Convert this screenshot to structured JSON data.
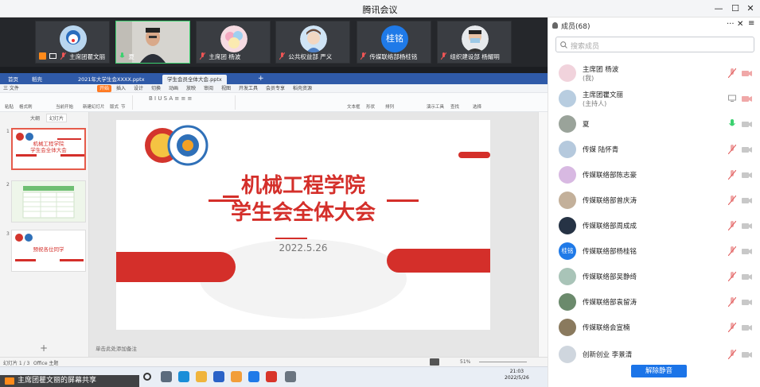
{
  "window": {
    "title": "腾讯会议",
    "min_label": "—",
    "max_label": "☐",
    "close_label": "✕"
  },
  "video_strip": [
    {
      "name": "主席团瞿文丽",
      "avatar_color": "#9ec3e6"
    },
    {
      "name": "夏",
      "avatar_color": "#c9c3ba"
    },
    {
      "name": "主席团 杨波",
      "avatar_color": "#f3d0d8"
    },
    {
      "name": "公共权益部 严义",
      "avatar_color": "#bcd7ee"
    },
    {
      "name": "传媒联络部杨桂铭",
      "avatar_color": "#1f7ae8",
      "avatar_text": "桂铭"
    },
    {
      "name": "组织建设部 杨耀明",
      "avatar_color": "#d8dde3"
    }
  ],
  "shared": {
    "tabs": [
      {
        "label": "首页"
      },
      {
        "label": "稻壳"
      },
      {
        "label": "2021年大学生会XXXX.pptx"
      },
      {
        "label": "学生会员全体大会.pptx"
      }
    ],
    "menus": [
      "三 文件",
      "开始",
      "插入",
      "设计",
      "切换",
      "动画",
      "放映",
      "审阅",
      "视图",
      "开发工具",
      "会员专享",
      "稻壳资源"
    ],
    "ribbon_items": [
      "粘贴",
      "格式刷",
      "当前开始",
      "新建幻灯片",
      "版式",
      "节",
      "文本框",
      "形状",
      "排列",
      "演示工具",
      "查找",
      "选择"
    ],
    "thumb_header": [
      "大纲",
      "幻灯片"
    ],
    "slide_numbers": [
      "1",
      "2",
      "3"
    ],
    "slide": {
      "title_line1": "机械工程学院",
      "title_line2": "学生会全体大会",
      "date": "2022.5.26",
      "title_color": "#d42f2a"
    },
    "thumb1": {
      "line1": "机械工程学院",
      "line2": "学生会全体大会"
    },
    "thumb3": {
      "text": "预祝各位同学"
    },
    "status_left": "幻灯片 1 / 3",
    "status_theme": "Office 主题",
    "notes_placeholder": "单击此处添加备注",
    "zoom": "51%",
    "clock": {
      "time": "21:03",
      "date": "2022/5/26"
    },
    "share_banner": "主席团瞿文丽的屏幕共享"
  },
  "panel": {
    "title": "成员(68)",
    "search_placeholder": "搜索成员",
    "members": [
      {
        "name": "主席团 杨波",
        "role": "(我)",
        "avatar_color": "#f1d3dc"
      },
      {
        "name": "主席团瞿文丽",
        "role": "(主持人)",
        "avatar_color": "#b8cde0"
      },
      {
        "name": "夏",
        "avatar_color": "#9aa39a"
      },
      {
        "name": "传媒 陆怀青",
        "avatar_color": "#b5c9dd"
      },
      {
        "name": "传媒联络部陈志豪",
        "avatar_color": "#d8b9e2"
      },
      {
        "name": "传媒联络部曾庆涛",
        "avatar_color": "#c3b09a"
      },
      {
        "name": "传媒联络部周成成",
        "avatar_color": "#263345"
      },
      {
        "name": "传媒联络部杨桂铭",
        "avatar_color": "#1f7ae8",
        "avatar_text": "桂铭"
      },
      {
        "name": "传媒联络部吴静绮",
        "avatar_color": "#a9c4b8"
      },
      {
        "name": "传媒联络部袁留涛",
        "avatar_color": "#6b8a6c"
      },
      {
        "name": "传媒联络会宣楠",
        "avatar_color": "#8a7a5e"
      },
      {
        "name": "创新创业 李景清",
        "avatar_color": "#cfd6de"
      }
    ],
    "unmute_label": "解除静音"
  }
}
